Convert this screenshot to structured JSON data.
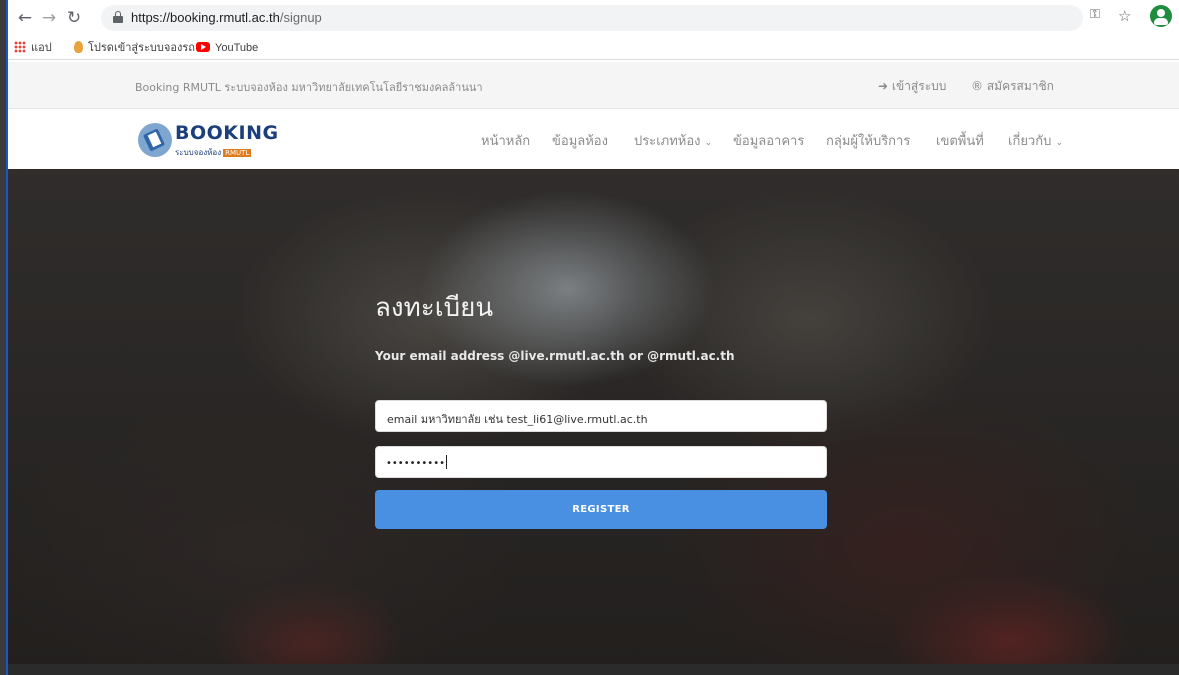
{
  "browser": {
    "url_host": "https://booking.rmutl.ac.th",
    "url_path": "/signup",
    "bookmarks": [
      "แอป",
      "โปรดเข้าสู่ระบบจองรถ",
      "YouTube"
    ]
  },
  "topbar": {
    "title": "Booking RMUTL ระบบจองห้อง มหาวิทยาลัยเทคโนโลยีราชมงคลล้านนา",
    "login_label": "เข้าสู่ระบบ",
    "register_label": "สมัครสมาชิก"
  },
  "logo": {
    "word": "BOOKING",
    "subtitle": "ระบบจองห้อง",
    "tag": "RMUTL"
  },
  "nav": {
    "items": [
      "หน้าหลัก",
      "ข้อมูลห้อง",
      "ประเภทห้อง",
      "ข้อมูลอาคาร",
      "กลุ่มผู้ให้บริการ",
      "เขตพื้นที่",
      "เกี่ยวกับ"
    ]
  },
  "form": {
    "heading": "ลงทะเบียน",
    "hint": "Your email address @live.rmutl.ac.th or @rmutl.ac.th",
    "email_value": "email มหาวิทยาลัย เช่น test_li61@live.rmutl.ac.th",
    "password_value": "••••••••••",
    "submit_label": "REGISTER"
  },
  "icons": [
    "back-icon",
    "forward-icon",
    "reload-icon",
    "lock-icon",
    "key-icon",
    "star-icon",
    "profile-icon",
    "apps-icon",
    "youtube-icon",
    "login-icon",
    "register-icon",
    "chevron-down-icon"
  ],
  "colors": {
    "accent": "#4a90e2",
    "brand": "#1b3f7a"
  }
}
